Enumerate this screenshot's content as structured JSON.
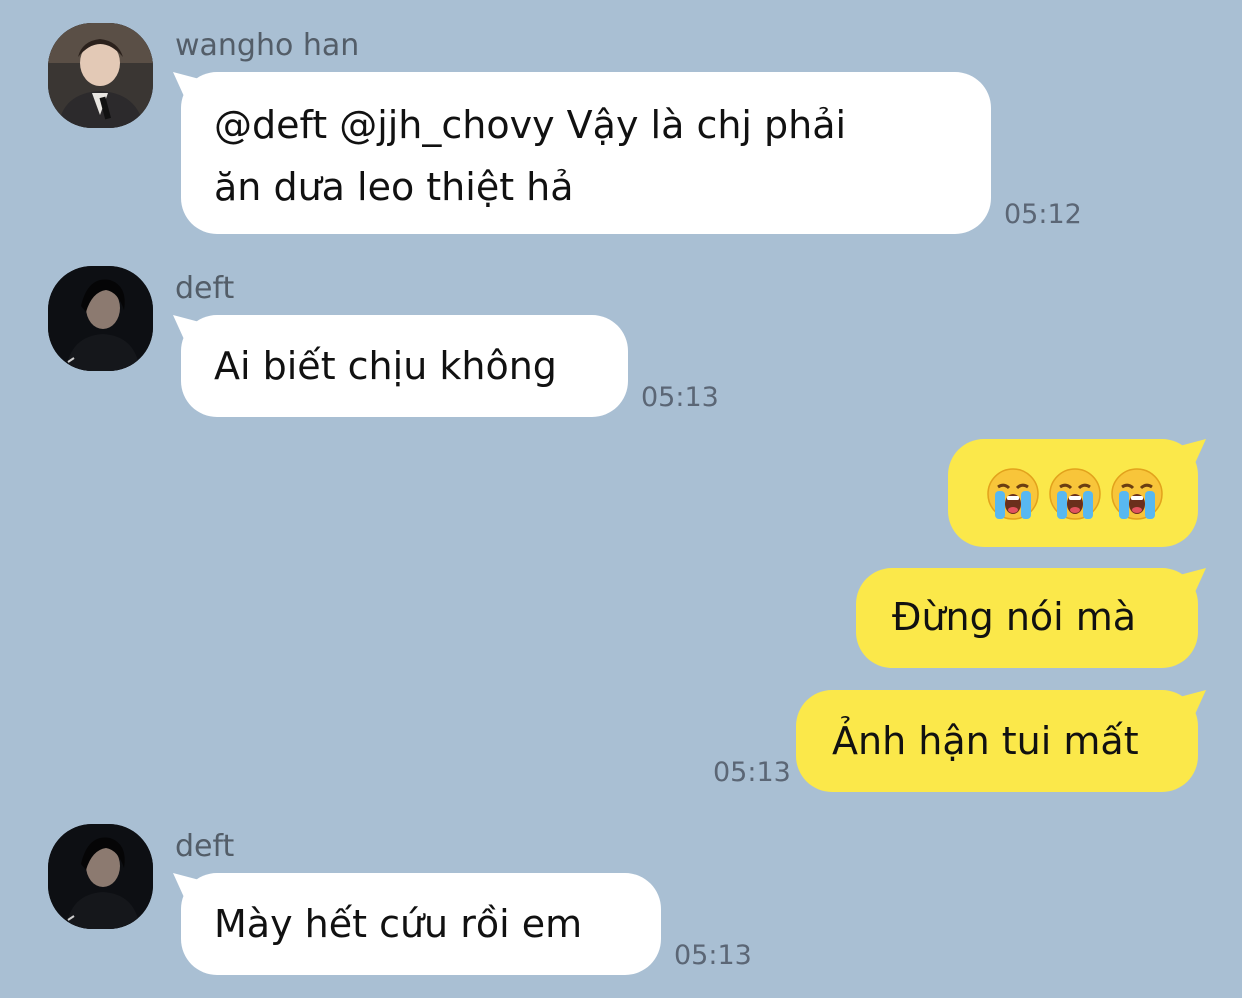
{
  "messages": [
    {
      "sender": "wangho han",
      "avatar": "avatar-wangho-han",
      "text": "@deft @jjh_chovy Vậy là chj phải\năn dưa leo thiệt hả",
      "time": "05:12",
      "direction": "incoming"
    },
    {
      "sender": "deft",
      "avatar": "avatar-deft",
      "text": "Ai biết chịu không",
      "time": "05:13",
      "direction": "incoming"
    },
    {
      "direction": "outgoing",
      "emoji": [
        "loudly-crying-face",
        "loudly-crying-face",
        "loudly-crying-face"
      ]
    },
    {
      "direction": "outgoing",
      "text": "Đừng nói mà"
    },
    {
      "direction": "outgoing",
      "text": "Ảnh hận tui mất",
      "time": "05:13"
    },
    {
      "sender": "deft",
      "avatar": "avatar-deft",
      "text": "Mày hết cứu rồi em",
      "time": "05:13",
      "direction": "incoming"
    }
  ],
  "colors": {
    "background": "#a9bfd3",
    "incoming_bubble": "#ffffff",
    "outgoing_bubble": "#fbe84a"
  }
}
